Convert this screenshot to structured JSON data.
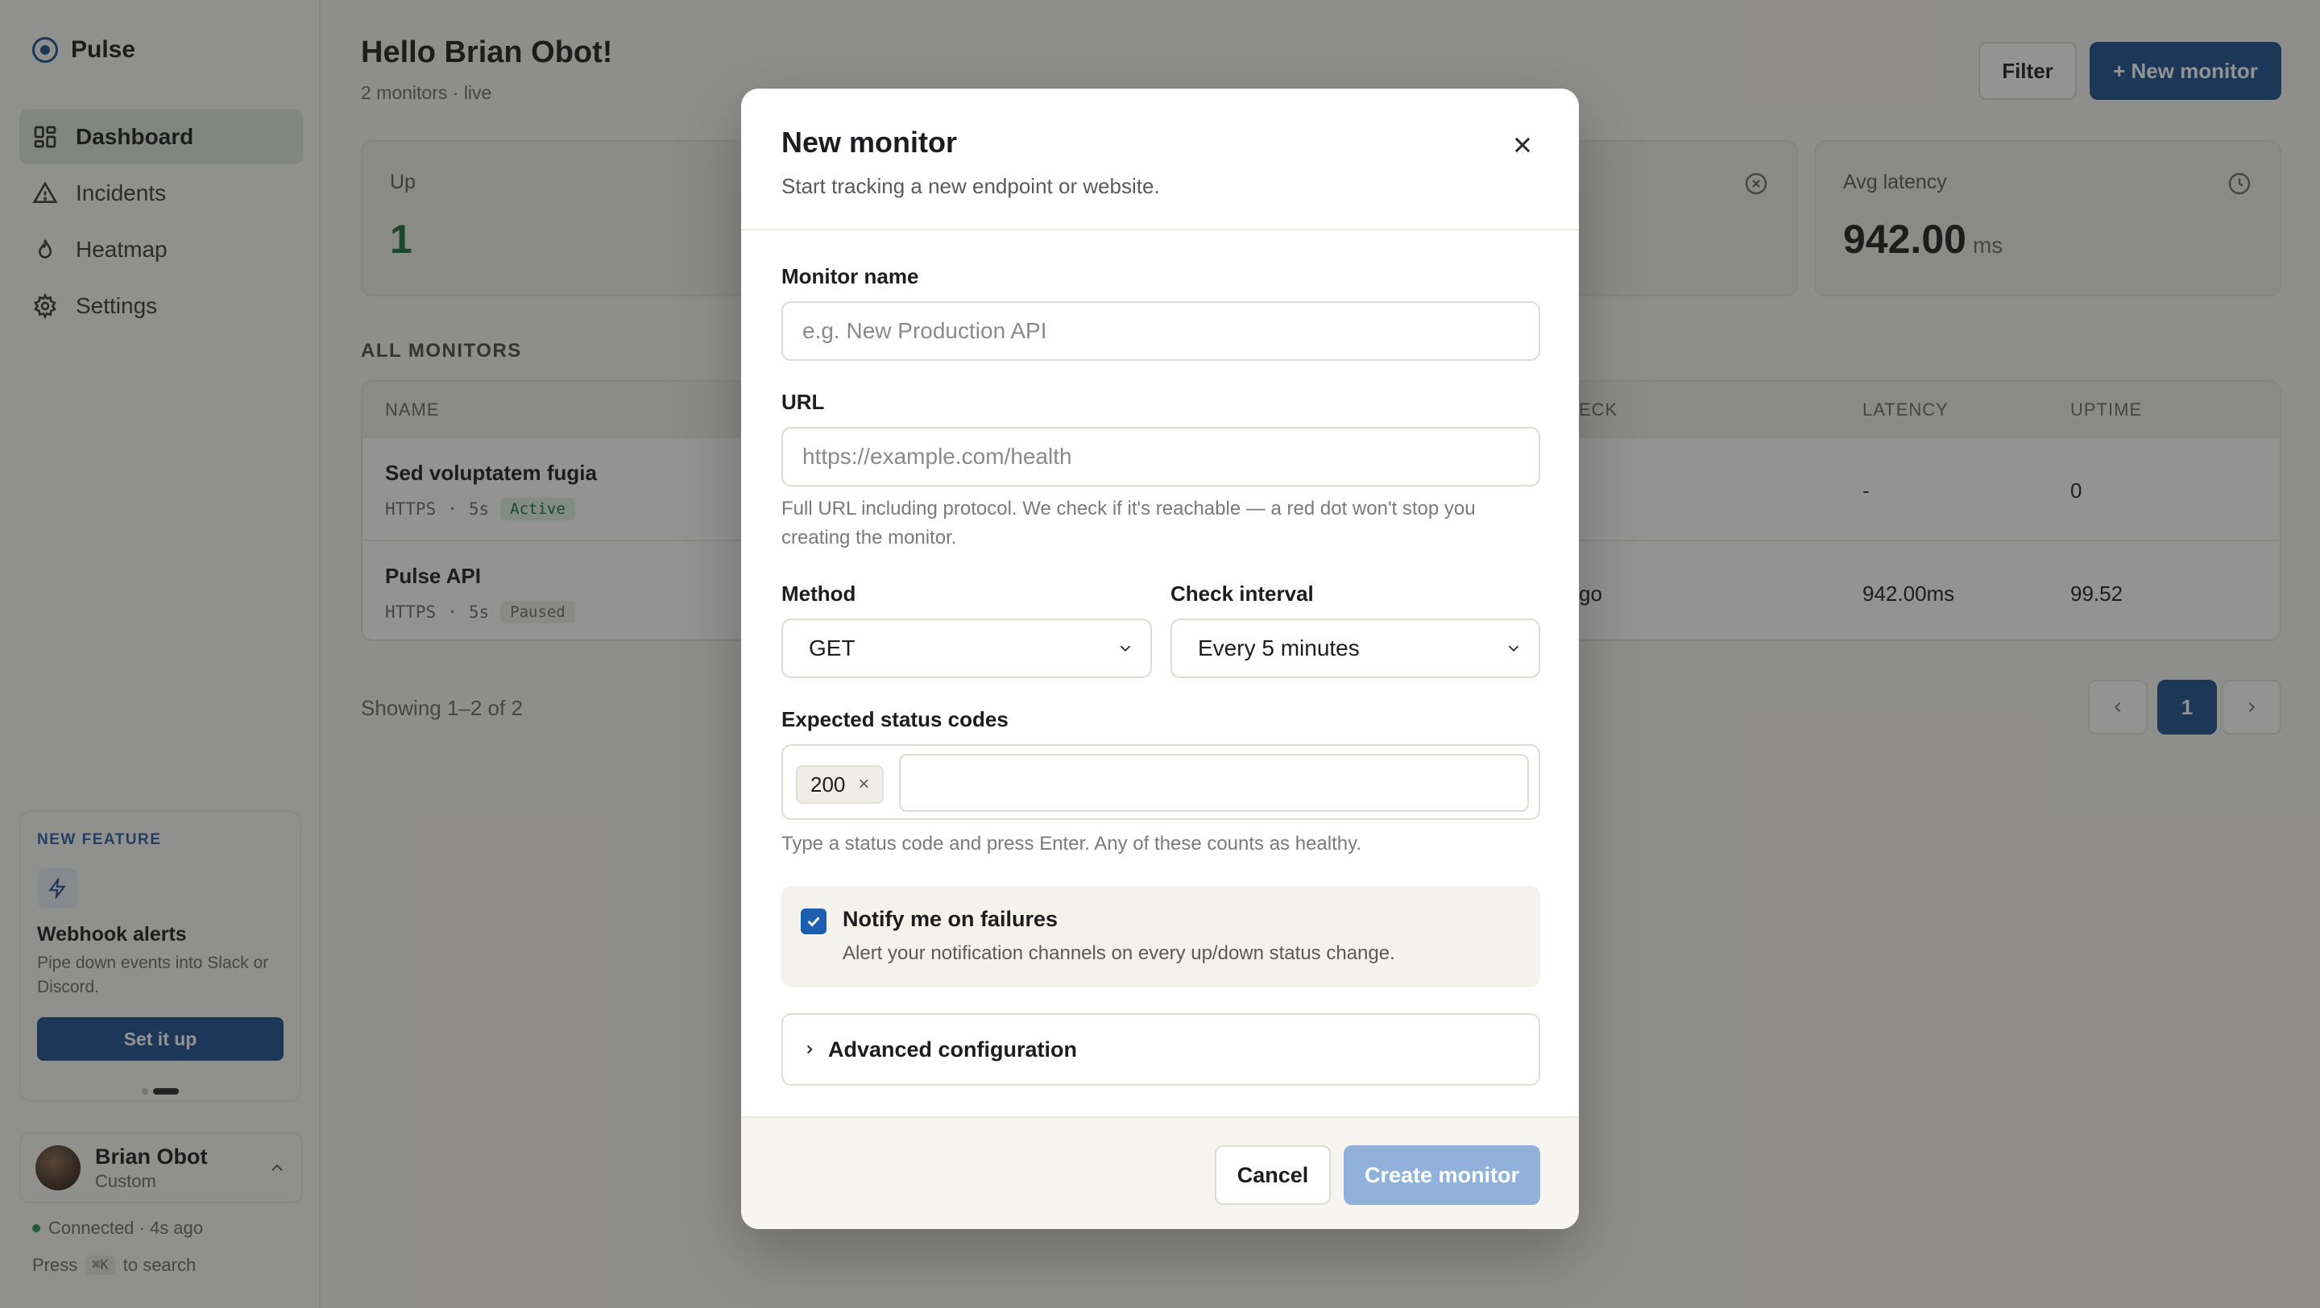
{
  "app": {
    "name": "Pulse"
  },
  "sidebar": {
    "items": [
      {
        "label": "Dashboard",
        "icon": "dashboard-icon",
        "active": true
      },
      {
        "label": "Incidents",
        "icon": "alert-triangle-icon"
      },
      {
        "label": "Heatmap",
        "icon": "flame-icon"
      },
      {
        "label": "Settings",
        "icon": "gear-icon"
      }
    ],
    "feature": {
      "eyebrow": "NEW FEATURE",
      "icon": "lightning-icon",
      "title": "Webhook alerts",
      "description": "Pipe down events into Slack or Discord.",
      "button": "Set it up"
    },
    "user": {
      "name": "Brian Obot",
      "plan": "Custom"
    },
    "connection": "Connected · 4s ago",
    "search_hint": {
      "prefix": "Press",
      "key": "⌘K",
      "suffix": "to search"
    }
  },
  "header": {
    "greeting": "Hello Brian Obot!",
    "subtitle": "2 monitors · live",
    "filter_label": "Filter",
    "new_monitor_label": "+ New monitor"
  },
  "stats": {
    "up": {
      "label": "Up",
      "value": "1"
    },
    "latency": {
      "label": "Avg latency",
      "value": "942.00",
      "unit": "ms"
    }
  },
  "monitors": {
    "section_title": "ALL MONITORS",
    "columns": {
      "name": "NAME",
      "check": "ECK",
      "latency": "LATENCY",
      "uptime": "UPTIME"
    },
    "rows": [
      {
        "name": "Sed voluptatem fugia",
        "protocol": "HTTPS",
        "interval": "5s",
        "status": "Active",
        "check": "",
        "latency": "-",
        "uptime": "0"
      },
      {
        "name": "Pulse API",
        "protocol": "HTTPS",
        "interval": "5s",
        "status": "Paused",
        "check": "go",
        "latency": "942.00ms",
        "uptime": "99.52"
      }
    ],
    "meta_sep": "·",
    "showing": "Showing 1–2 of 2",
    "pagination": {
      "current": "1"
    }
  },
  "modal": {
    "title": "New monitor",
    "subtitle": "Start tracking a new endpoint or website.",
    "name_label": "Monitor name",
    "name_placeholder": "e.g. New Production API",
    "url_label": "URL",
    "url_placeholder": "https://example.com/health",
    "url_help": "Full URL including protocol. We check if it's reachable — a red dot won't stop you creating the monitor.",
    "method_label": "Method",
    "method_value": "GET",
    "interval_label": "Check interval",
    "interval_value": "Every 5 minutes",
    "codes_label": "Expected status codes",
    "codes": [
      "200"
    ],
    "codes_help": "Type a status code and press Enter. Any of these counts as healthy.",
    "notify_title": "Notify me on failures",
    "notify_desc": "Alert your notification channels on every up/down status change.",
    "notify_checked": true,
    "advanced_label": "Advanced configuration",
    "cancel_label": "Cancel",
    "create_label": "Create monitor"
  },
  "colors": {
    "primary": "#1c4f8f",
    "primary_disabled": "#90b2da",
    "success": "#1f6b3a"
  }
}
